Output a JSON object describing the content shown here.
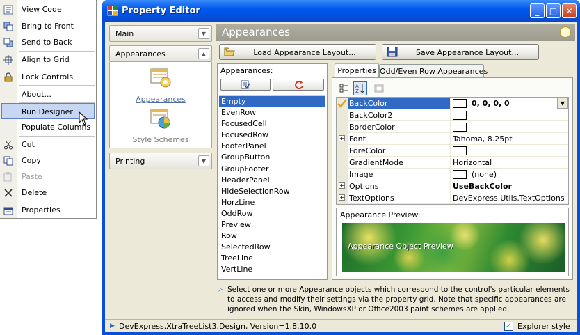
{
  "context_menu": {
    "items": [
      {
        "label": "View Code",
        "icon": "view-code-icon"
      },
      {
        "label": "Bring to Front",
        "icon": "bring-to-front-icon"
      },
      {
        "label": "Send to Back",
        "icon": "send-to-back-icon"
      },
      {
        "label": "Align to Grid",
        "icon": "align-to-grid-icon"
      },
      {
        "label": "Lock Controls",
        "icon": "lock-icon"
      },
      {
        "label": "About...",
        "icon": ""
      },
      {
        "label": "Run Designer",
        "icon": "",
        "highlighted": true
      },
      {
        "label": "Populate Columns",
        "icon": ""
      },
      {
        "label": "Cut",
        "icon": "scissors-icon"
      },
      {
        "label": "Copy",
        "icon": "copy-icon"
      },
      {
        "label": "Paste",
        "icon": "paste-icon",
        "disabled": true
      },
      {
        "label": "Delete",
        "icon": "delete-icon"
      },
      {
        "label": "Properties",
        "icon": "properties-icon"
      }
    ]
  },
  "window": {
    "title": "Property Editor",
    "controls": {
      "minimize": "_",
      "maximize": "□",
      "close": "✕"
    }
  },
  "nav": {
    "main": "Main",
    "appearances": "Appearances",
    "printing": "Printing",
    "links": [
      "Appearances",
      "Style Schemes"
    ]
  },
  "header": {
    "title": "Appearances"
  },
  "buttons": {
    "load": "Load Appearance Layout...",
    "save": "Save Appearance Layout..."
  },
  "appearances_list": {
    "title": "Appearances:",
    "items": [
      "Empty",
      "EvenRow",
      "FocusedCell",
      "FocusedRow",
      "FooterPanel",
      "GroupButton",
      "GroupFooter",
      "HeaderPanel",
      "HideSelectionRow",
      "HorzLine",
      "OddRow",
      "Preview",
      "Row",
      "SelectedRow",
      "TreeLine",
      "VertLine"
    ],
    "selected": "Empty"
  },
  "tabs": [
    "Properties",
    "Odd/Even Row Appearances"
  ],
  "property_grid": {
    "rows": [
      {
        "name": "BackColor",
        "value": "0, 0, 0, 0",
        "swatch": true,
        "bold": true,
        "selected": true,
        "expandable": false
      },
      {
        "name": "BackColor2",
        "value": "",
        "swatch": true,
        "expandable": false
      },
      {
        "name": "BorderColor",
        "value": "",
        "swatch": true,
        "expandable": false
      },
      {
        "name": "Font",
        "value": "Tahoma, 8.25pt",
        "swatch": false,
        "expandable": true
      },
      {
        "name": "ForeColor",
        "value": "",
        "swatch": true,
        "expandable": false
      },
      {
        "name": "GradientMode",
        "value": "Horizontal",
        "swatch": false,
        "expandable": false
      },
      {
        "name": "Image",
        "value": "(none)",
        "swatch": true,
        "expandable": false
      },
      {
        "name": "Options",
        "value": "UseBackColor",
        "swatch": false,
        "bold": true,
        "expandable": true
      },
      {
        "name": "TextOptions",
        "value": "DevExpress.Utils.TextOptions",
        "swatch": false,
        "expandable": true
      }
    ]
  },
  "preview": {
    "title": "Appearance Preview:",
    "text": "Appearance Object Preview"
  },
  "description": "Select one or more Appearance objects which correspond to the control's particular elements to access and modify their settings via the property grid. Note that specific appearances are ignored when the Skin, WindowsXP or Office2003 paint schemes are applied.",
  "status": {
    "text": "DevExpress.XtraTreeList3.Design, Version=1.8.10.0",
    "explorer_style": "Explorer style",
    "explorer_style_checked": true
  }
}
